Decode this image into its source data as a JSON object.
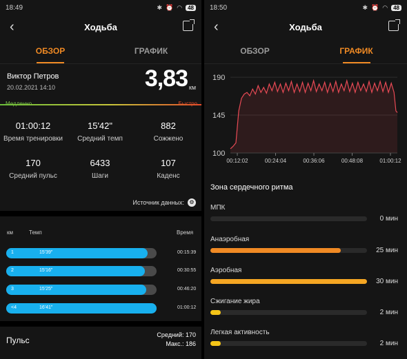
{
  "left": {
    "status_time": "18:49",
    "battery": "48",
    "title": "Ходьба",
    "tabs": [
      "ОБЗОР",
      "ГРАФИК"
    ],
    "active_tab": 0,
    "user_name": "Виктор Петров",
    "datetime": "20.02.2021 14:10",
    "distance": "3,83",
    "distance_unit": "км",
    "speed_slow": "Медленно",
    "speed_fast": "Быстро",
    "stats": [
      {
        "value": "01:00:12",
        "label": "Время тренировки"
      },
      {
        "value": "15'42\"",
        "label": "Средний темп"
      },
      {
        "value": "882",
        "label": "Сожжено"
      },
      {
        "value": "170",
        "label": "Средний пульс"
      },
      {
        "value": "6433",
        "label": "Шаги"
      },
      {
        "value": "107",
        "label": "Каденс"
      }
    ],
    "source_label": "Источник данных:",
    "table_headers": {
      "km": "км",
      "pace": "Темп",
      "time": "Время"
    },
    "laps": [
      {
        "km": "1",
        "pace": "15'39\"",
        "time": "00:15:39",
        "fill": 0.94
      },
      {
        "km": "2",
        "pace": "15'16\"",
        "time": "00:30:55",
        "fill": 0.92
      },
      {
        "km": "3",
        "pace": "15'25\"",
        "time": "00:46:20",
        "fill": 0.93
      },
      {
        "km": "<4",
        "pace": "16'41\"",
        "time": "01:00:12",
        "fill": 1.0
      }
    ],
    "pulse_label": "Пульс",
    "pulse_avg": "Средний: 170",
    "pulse_max": "Макс.: 186"
  },
  "right": {
    "status_time": "18:50",
    "battery": "48",
    "title": "Ходьба",
    "tabs": [
      "ОБЗОР",
      "ГРАФИК"
    ],
    "active_tab": 1,
    "zone_title": "Зона сердечного ритма",
    "zones": [
      {
        "name": "МПК",
        "value": "0 мин",
        "minutes": 0,
        "color": "#f08a24"
      },
      {
        "name": "Анаэробная",
        "value": "25 мин",
        "minutes": 25,
        "color": "#f08a24"
      },
      {
        "name": "Аэробная",
        "value": "30 мин",
        "minutes": 30,
        "color": "#f5a623"
      },
      {
        "name": "Сжигание жира",
        "value": "2 мин",
        "minutes": 2,
        "color": "#f5c518"
      },
      {
        "name": "Легкая активность",
        "value": "2 мин",
        "minutes": 2,
        "color": "#f5c518"
      }
    ]
  },
  "chart_data": {
    "type": "line",
    "title": "",
    "xlabel": "",
    "ylabel": "",
    "x_ticks": [
      "00:12:02",
      "00:24:04",
      "00:36:06",
      "00:48:08",
      "01:00:12"
    ],
    "y_ticks": [
      100,
      145,
      190
    ],
    "ylim": [
      100,
      195
    ],
    "x_seconds_range": [
      0,
      3612
    ],
    "color": "#e84a55",
    "series": [
      {
        "x": [
          0,
          60,
          120,
          180,
          240,
          300,
          360,
          420,
          480,
          540,
          600,
          660,
          720,
          780,
          840,
          900,
          960,
          1020,
          1080,
          1140,
          1200,
          1260,
          1320,
          1380,
          1440,
          1500,
          1560,
          1620,
          1680,
          1740,
          1800,
          1860,
          1920,
          1980,
          2040,
          2100,
          2160,
          2220,
          2280,
          2340,
          2400,
          2460,
          2520,
          2580,
          2640,
          2700,
          2760,
          2820,
          2880,
          2940,
          3000,
          3060,
          3120,
          3180,
          3240,
          3300,
          3360,
          3420,
          3480,
          3540,
          3580,
          3612
        ],
        "values": [
          105,
          108,
          112,
          150,
          165,
          170,
          172,
          168,
          176,
          170,
          180,
          172,
          178,
          171,
          182,
          174,
          184,
          173,
          182,
          172,
          183,
          174,
          185,
          172,
          182,
          173,
          184,
          172,
          183,
          174,
          186,
          173,
          182,
          174,
          184,
          172,
          183,
          173,
          185,
          172,
          182,
          174,
          186,
          173,
          183,
          172,
          184,
          174,
          182,
          173,
          185,
          172,
          183,
          174,
          185,
          173,
          184,
          172,
          183,
          172,
          150,
          148
        ]
      }
    ]
  }
}
